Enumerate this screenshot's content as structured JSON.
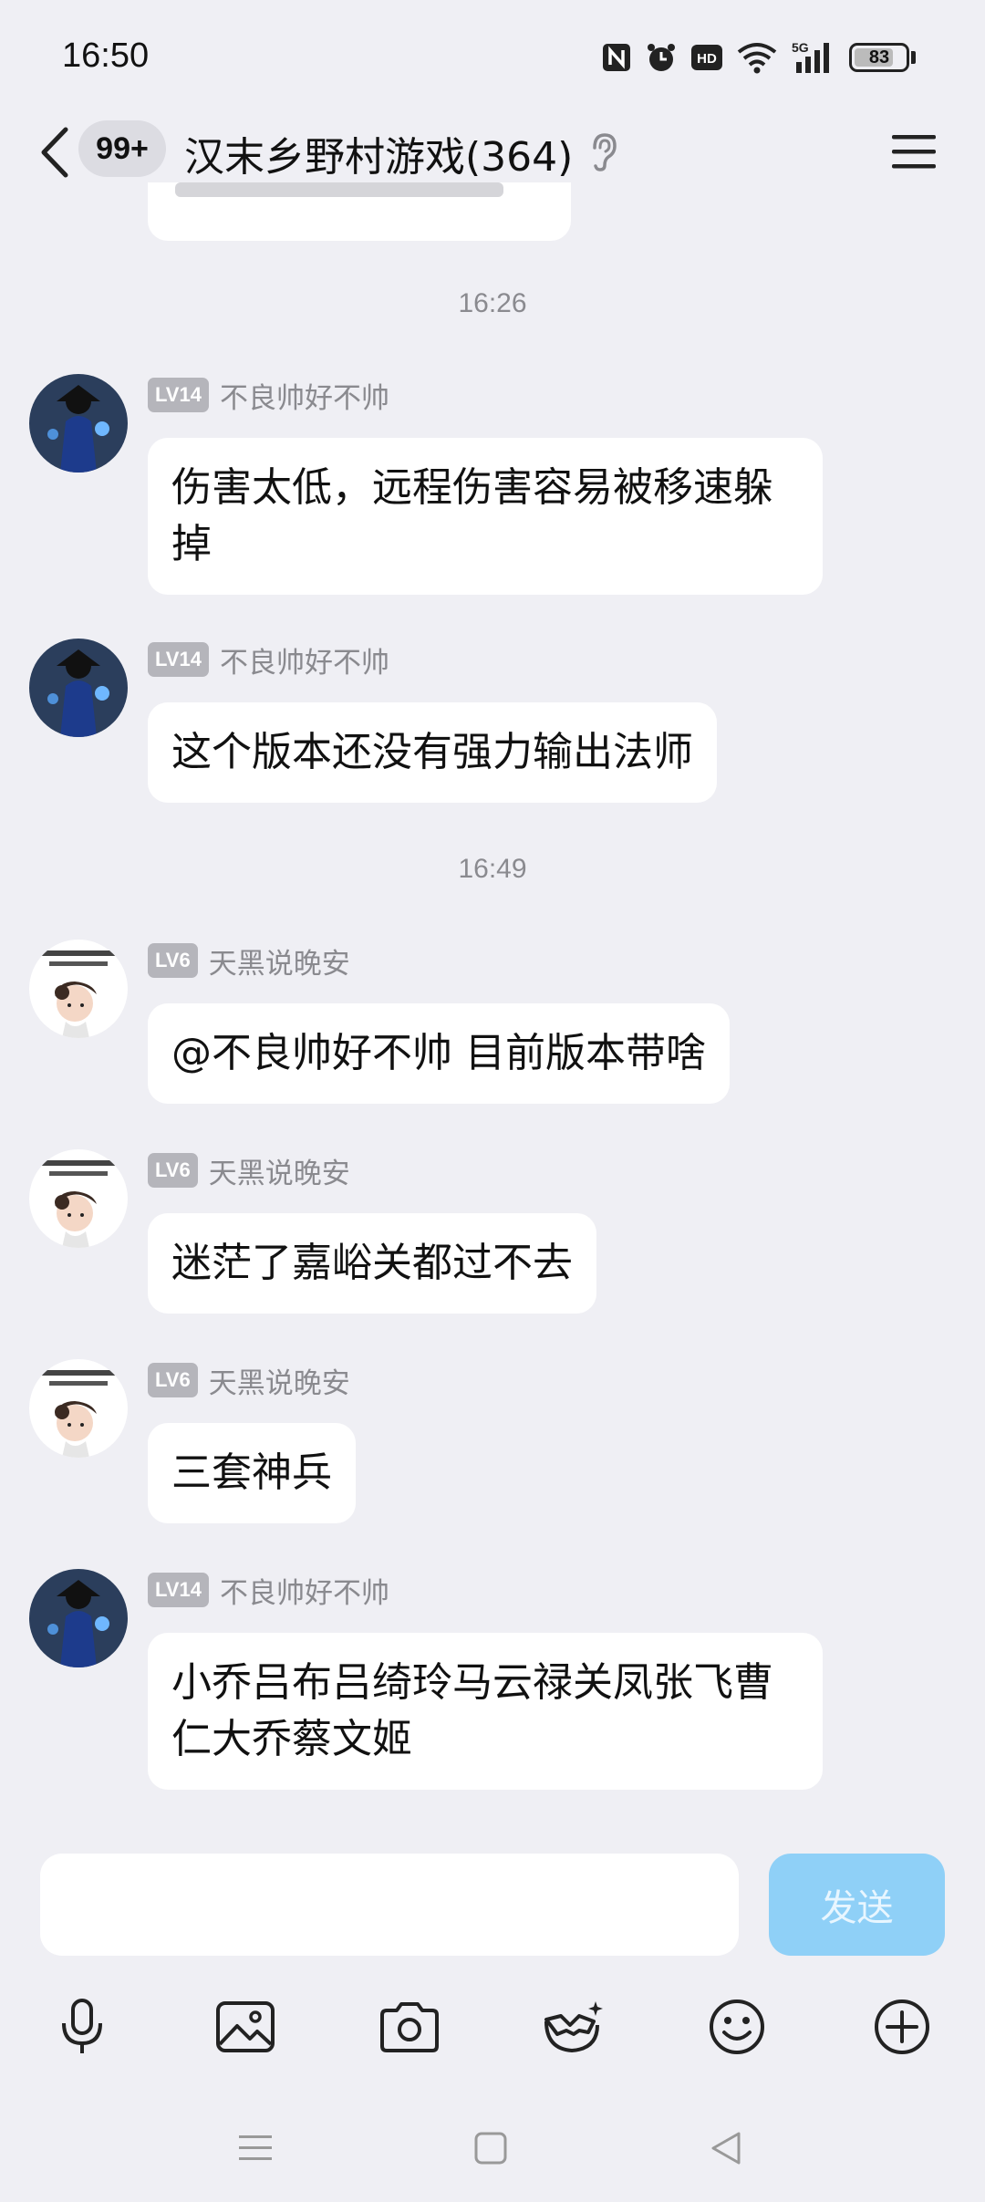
{
  "status_bar": {
    "time": "16:50",
    "network": "5G",
    "battery": "83",
    "icons": [
      "nfc-icon",
      "alarm-icon",
      "hd-icon",
      "wifi-icon",
      "signal-icon",
      "battery-icon"
    ]
  },
  "header": {
    "unread_badge": "99+",
    "title": "汉末乡野村游戏(364)",
    "icons": [
      "back-arrow-icon",
      "ear-icon",
      "menu-icon"
    ]
  },
  "messages": {
    "timestamps": [
      "16:26",
      "16:49"
    ],
    "items": [
      {
        "level": "LV14",
        "sender": "不良帅好不帅",
        "text": "伤害太低，远程伤害容易被移速躲掉"
      },
      {
        "level": "LV14",
        "sender": "不良帅好不帅",
        "text": "这个版本还没有强力输出法师"
      },
      {
        "level": "LV6",
        "sender": "天黑说晚安",
        "text": "@不良帅好不帅 目前版本带啥"
      },
      {
        "level": "LV6",
        "sender": "天黑说晚安",
        "text": "迷茫了嘉峪关都过不去"
      },
      {
        "level": "LV6",
        "sender": "天黑说晚安",
        "text": "三套神兵"
      },
      {
        "level": "LV14",
        "sender": "不良帅好不帅",
        "text": "小乔吕布吕绮玲马云禄关凤张飞曹仁大乔蔡文姬"
      }
    ]
  },
  "input": {
    "value": "",
    "send_label": "发送"
  },
  "toolbar": {
    "icons": [
      "microphone-icon",
      "image-icon",
      "camera-icon",
      "mask-sticker-icon",
      "smiley-icon",
      "plus-icon"
    ]
  },
  "nav_bar": {
    "icons": [
      "menu-nav-icon",
      "home-nav-icon",
      "back-nav-icon"
    ]
  },
  "colors": {
    "background": "#efeff4",
    "bubble": "#ffffff",
    "send_button": "#8fd0f7",
    "level_badge": "#b5b5bb",
    "meta_text": "#8a8a8f"
  }
}
